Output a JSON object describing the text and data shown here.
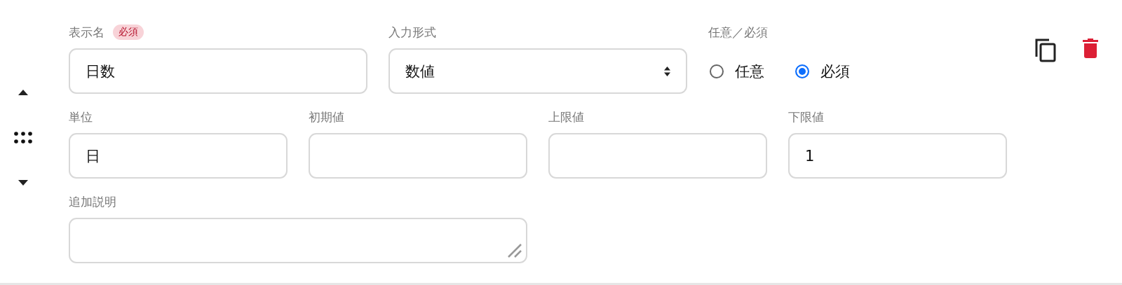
{
  "display_name": {
    "label": "表示名",
    "badge": "必須",
    "value": "日数"
  },
  "input_type": {
    "label": "入力形式",
    "value": "数値"
  },
  "requirement": {
    "label": "任意／必須",
    "options": [
      {
        "label": "任意",
        "selected": false
      },
      {
        "label": "必須",
        "selected": true
      }
    ]
  },
  "number_fields": [
    {
      "label": "単位",
      "value": "日"
    },
    {
      "label": "初期値"
    },
    {
      "label": "上限値"
    },
    {
      "label": "下限値",
      "value": "1"
    }
  ],
  "description": {
    "label": "追加説明"
  }
}
